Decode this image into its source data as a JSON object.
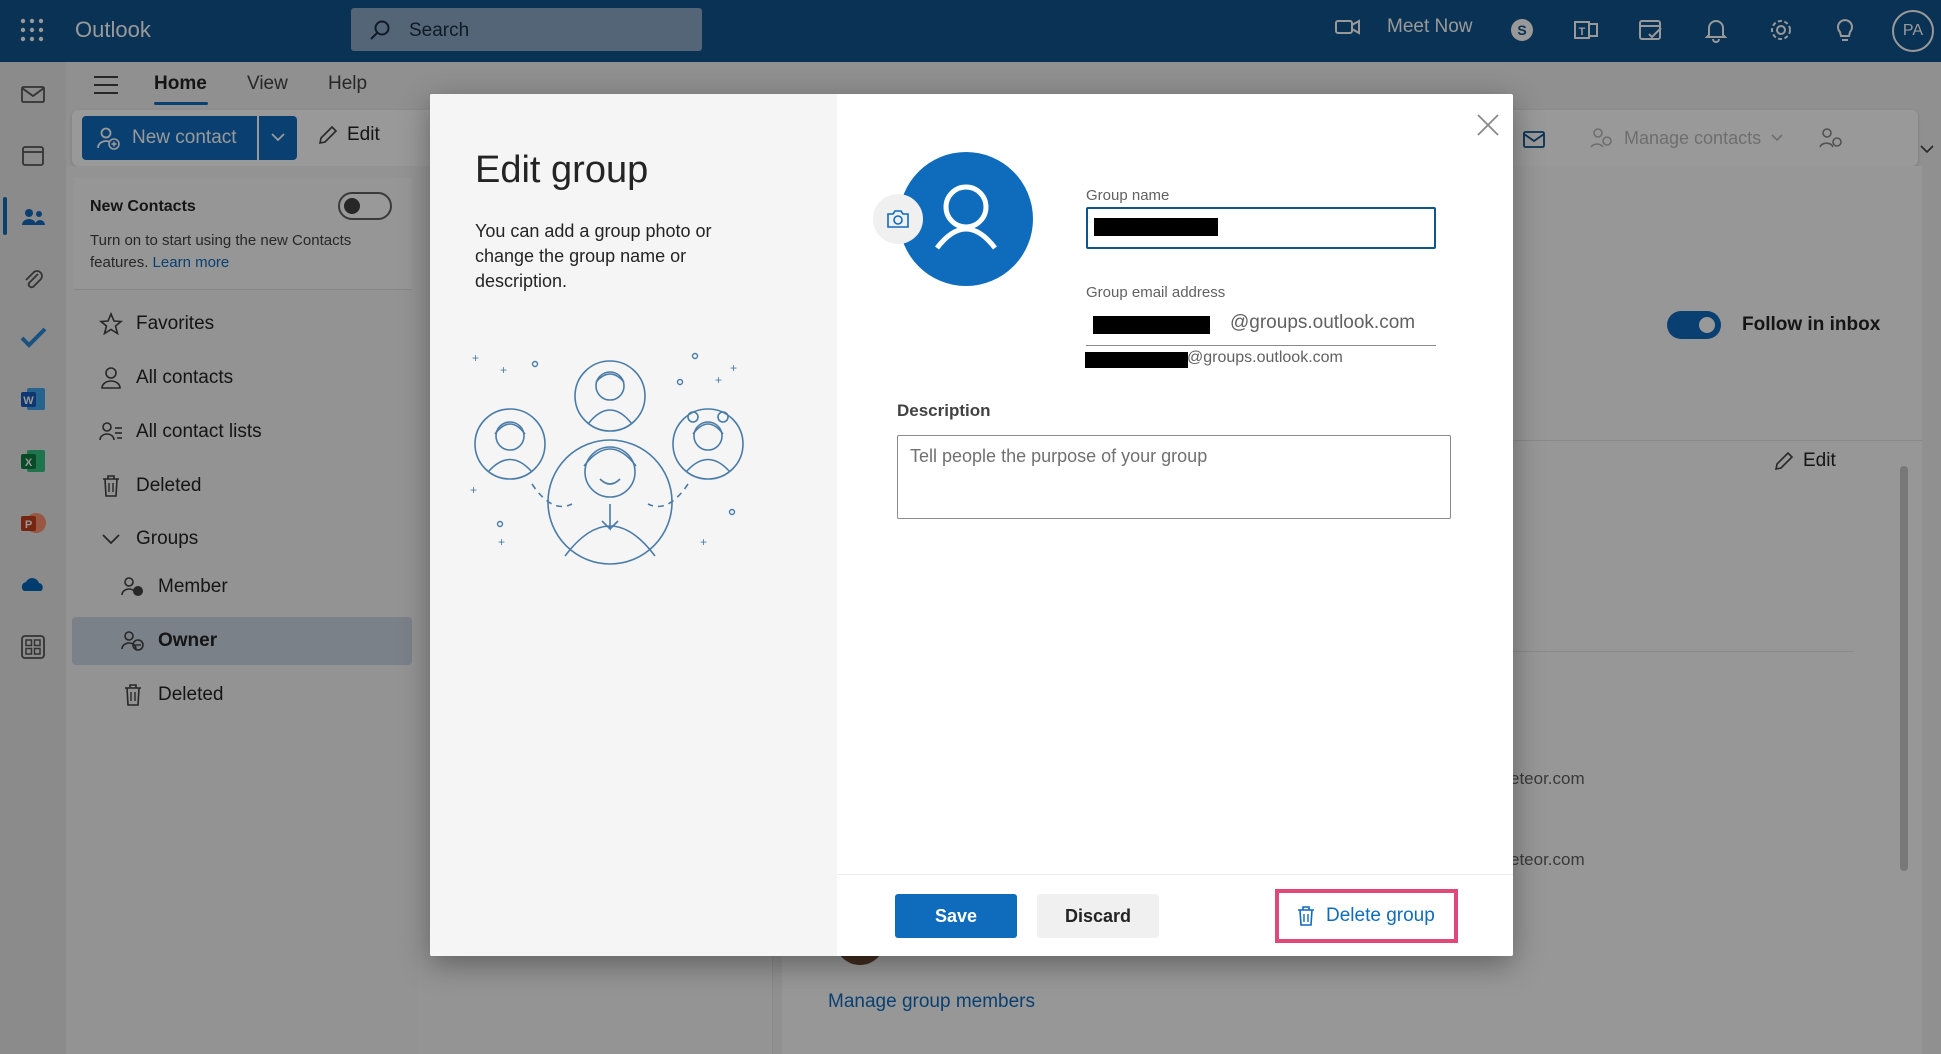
{
  "app": {
    "title": "Outlook",
    "user_initials": "PA"
  },
  "search": {
    "placeholder": "Search"
  },
  "topbar": {
    "meet_now": "Meet Now"
  },
  "ribbon": {
    "tabs": [
      "Home",
      "View",
      "Help"
    ],
    "new_contact": "New contact",
    "edit": "Edit",
    "manage_contacts": "Manage contacts"
  },
  "nav": {
    "new_contacts_title": "New Contacts",
    "new_contacts_desc": "Turn on to start using the new Contacts features.",
    "learn_more": "Learn more",
    "items": {
      "favorites": "Favorites",
      "all_contacts": "All contacts",
      "all_contact_lists": "All contact lists",
      "deleted": "Deleted",
      "groups": "Groups",
      "member": "Member",
      "owner": "Owner",
      "groups_deleted": "Deleted"
    }
  },
  "background": {
    "follow_in_inbox": "Follow in inbox",
    "edit": "Edit",
    "email_fragment_1": "eteor.com",
    "email_fragment_2": "eteor.com",
    "manage_group_members": "Manage group members"
  },
  "dialog": {
    "title": "Edit group",
    "description": "You can add a group photo or change the group name or description.",
    "group_name_label": "Group name",
    "group_email_label": "Group email address",
    "email_domain": "@groups.outlook.com",
    "email_preview_domain": "@groups.outlook.com",
    "description_label": "Description",
    "description_placeholder": "Tell people the purpose of your group",
    "save": "Save",
    "discard": "Discard",
    "delete_group": "Delete group"
  },
  "colors": {
    "brand_blue": "#0f548c",
    "accent": "#0f6cbd",
    "highlight": "#e0487a"
  }
}
